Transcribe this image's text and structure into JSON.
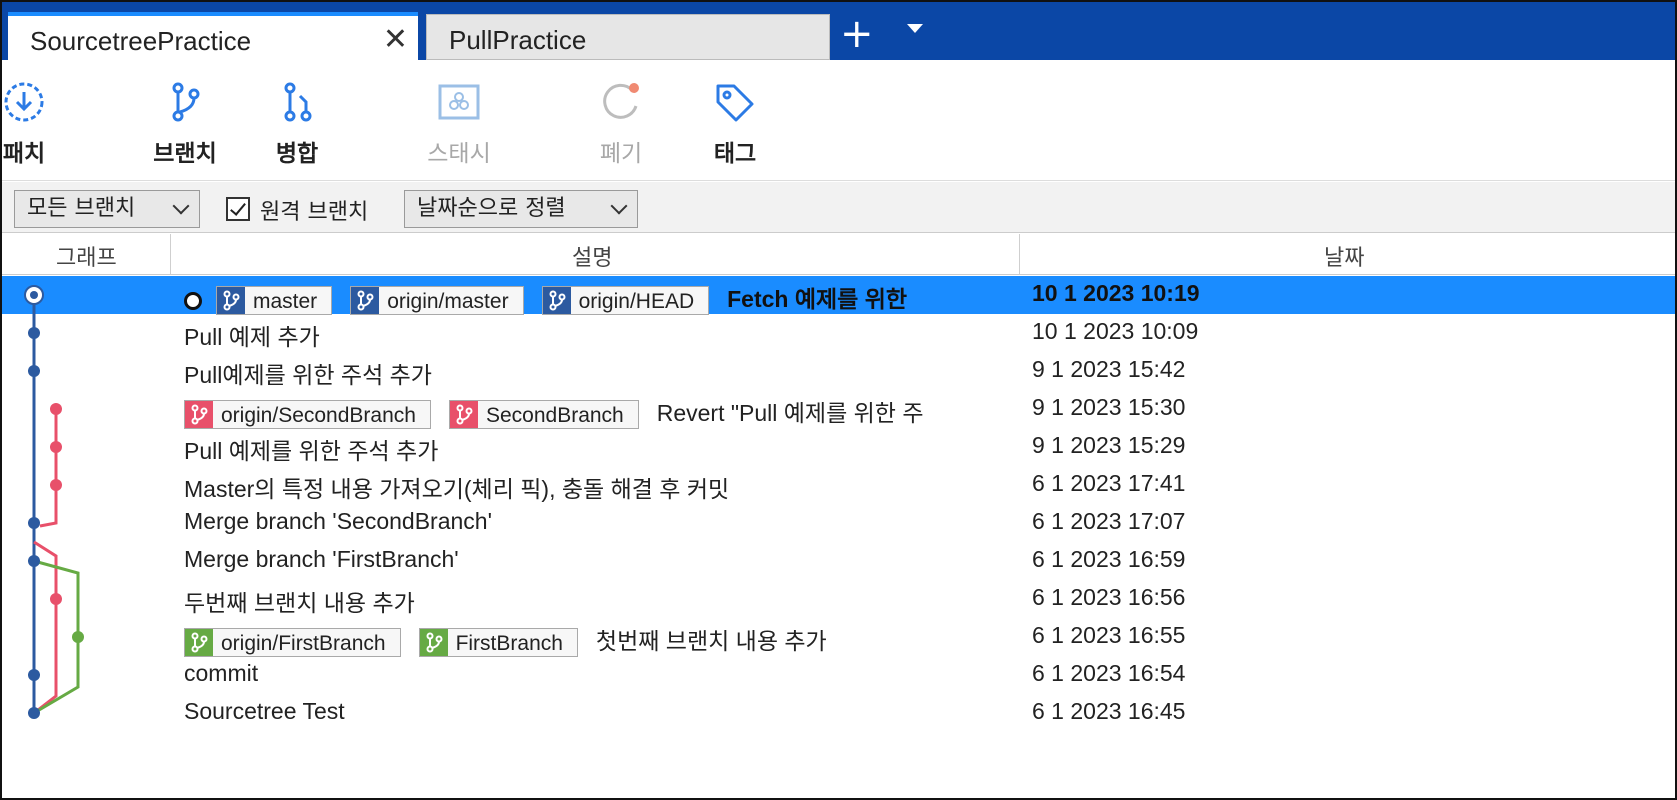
{
  "tabs": [
    {
      "label": "SourcetreePractice",
      "active": true
    },
    {
      "label": "PullPractice",
      "active": false
    }
  ],
  "toolbar": {
    "fetch_label": "패치",
    "branch_label": "브랜치",
    "merge_label": "병합",
    "stash_label": "스태시",
    "discard_label": "폐기",
    "tag_label": "태그"
  },
  "filters": {
    "branch_filter": "모든 브랜치",
    "remote_branches_label": "원격 브랜치",
    "remote_branches_checked": true,
    "sort": "날짜순으로 정렬"
  },
  "columns": {
    "graph": "그래프",
    "description": "설명",
    "date": "날짜"
  },
  "colors": {
    "accent": "#0b47a6",
    "selection": "#1a8cff",
    "branch_blue": "#2c5aa0",
    "branch_red": "#e8506a",
    "branch_green": "#66aa44"
  },
  "commits": [
    {
      "refs": [
        {
          "name": "master",
          "color": "blue"
        },
        {
          "name": "origin/master",
          "color": "blue"
        },
        {
          "name": "origin/HEAD",
          "color": "blue"
        }
      ],
      "message": "Fetch 예제를 위한",
      "date": "10 1 2023 10:19",
      "selected": true,
      "head": true
    },
    {
      "refs": [],
      "message": "Pull 예제 추가",
      "date": "10 1 2023 10:09"
    },
    {
      "refs": [],
      "message": "Pull예제를 위한 주석 추가",
      "date": "9 1 2023 15:42"
    },
    {
      "refs": [
        {
          "name": "origin/SecondBranch",
          "color": "red"
        },
        {
          "name": "SecondBranch",
          "color": "red"
        }
      ],
      "message": "Revert \"Pull 예제를 위한 주",
      "date": "9 1 2023 15:30"
    },
    {
      "refs": [],
      "message": "Pull 예제를 위한 주석 추가",
      "date": "9 1 2023 15:29"
    },
    {
      "refs": [],
      "message": "Master의 특정 내용 가져오기(체리 픽), 충돌 해결 후 커밋",
      "date": "6 1 2023 17:41"
    },
    {
      "refs": [],
      "message": "Merge branch 'SecondBranch'",
      "date": "6 1 2023 17:07"
    },
    {
      "refs": [],
      "message": "Merge branch 'FirstBranch'",
      "date": "6 1 2023 16:59"
    },
    {
      "refs": [],
      "message": "두번째 브랜치 내용 추가",
      "date": "6 1 2023 16:56"
    },
    {
      "refs": [
        {
          "name": "origin/FirstBranch",
          "color": "green"
        },
        {
          "name": "FirstBranch",
          "color": "green"
        }
      ],
      "message": "첫번째 브랜치 내용 추가",
      "date": "6 1 2023 16:55"
    },
    {
      "refs": [],
      "message": "commit",
      "date": "6 1 2023 16:54"
    },
    {
      "refs": [],
      "message": "Sourcetree Test",
      "date": "6 1 2023 16:45"
    }
  ]
}
